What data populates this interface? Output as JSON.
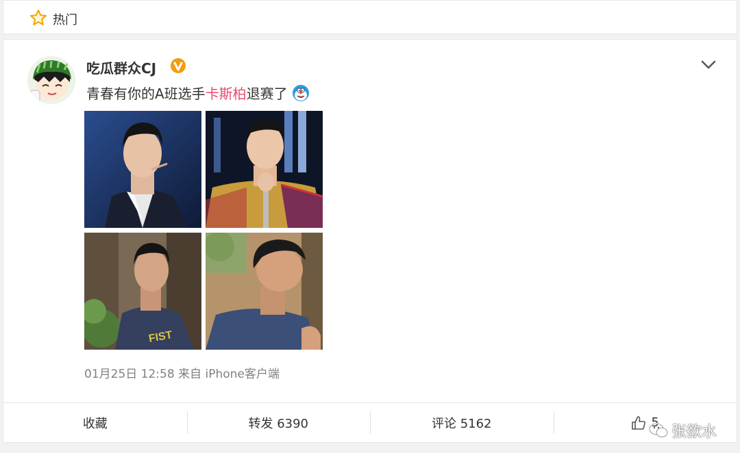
{
  "hot_bar": {
    "label": "热门",
    "icon": "star-icon"
  },
  "post": {
    "username": "吃瓜群众CJ",
    "verified_badge": "verified-v-icon",
    "text_before": "青春有你的A班选手",
    "text_highlight": "卡斯柏",
    "text_after": "退赛了",
    "emoji": "doraemon-icon",
    "meta": "01月25日 12:58 来自 iPhone客户端",
    "highlight_color": "#eb4b6f"
  },
  "actions": {
    "favorite": "收藏",
    "repost": "转发 6390",
    "comment": "评论 5162",
    "like_count": "5"
  },
  "watermark": {
    "text": "张欲水"
  }
}
